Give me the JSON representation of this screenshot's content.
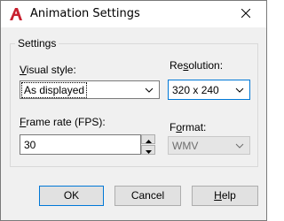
{
  "window": {
    "title": "Animation Settings",
    "app_icon": "autocad-icon",
    "close_icon": "close-icon"
  },
  "settings_group": {
    "legend": "Settings",
    "visual_style": {
      "label_prefix": "",
      "label_underlined": "V",
      "label_rest": "isual style:",
      "value": "As displayed"
    },
    "resolution": {
      "label_prefix": "Re",
      "label_underlined": "s",
      "label_rest": "olution:",
      "value": "320 x 240"
    },
    "frame_rate": {
      "label_prefix": "",
      "label_underlined": "F",
      "label_rest": "rame rate (FPS):",
      "value": "30"
    },
    "format": {
      "label_prefix": "F",
      "label_underlined": "o",
      "label_rest": "rmat:",
      "value": "WMV"
    }
  },
  "buttons": {
    "ok": "OK",
    "cancel": "Cancel",
    "help_prefix": "",
    "help_underlined": "H",
    "help_rest": "elp"
  },
  "colors": {
    "accent": "#0078d7",
    "app_icon_red": "#c8202f"
  }
}
